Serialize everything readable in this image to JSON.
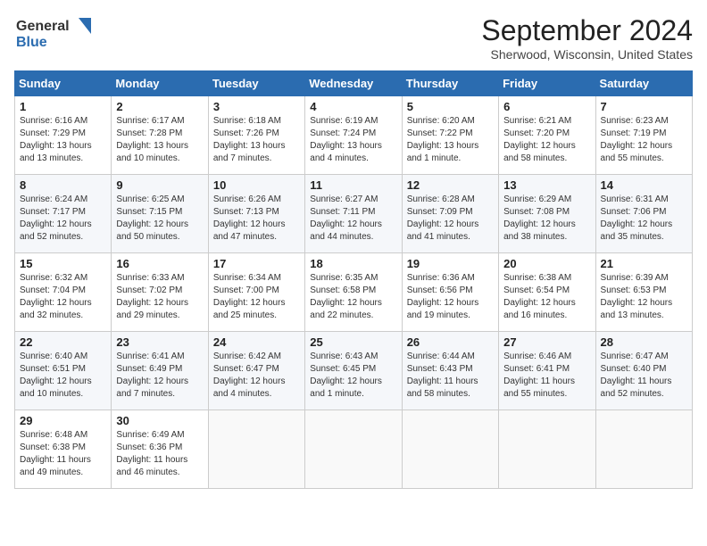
{
  "header": {
    "logo_line1": "General",
    "logo_line2": "Blue",
    "month_year": "September 2024",
    "location": "Sherwood, Wisconsin, United States"
  },
  "days_of_week": [
    "Sunday",
    "Monday",
    "Tuesday",
    "Wednesday",
    "Thursday",
    "Friday",
    "Saturday"
  ],
  "weeks": [
    [
      {
        "day": "1",
        "text": "Sunrise: 6:16 AM\nSunset: 7:29 PM\nDaylight: 13 hours\nand 13 minutes."
      },
      {
        "day": "2",
        "text": "Sunrise: 6:17 AM\nSunset: 7:28 PM\nDaylight: 13 hours\nand 10 minutes."
      },
      {
        "day": "3",
        "text": "Sunrise: 6:18 AM\nSunset: 7:26 PM\nDaylight: 13 hours\nand 7 minutes."
      },
      {
        "day": "4",
        "text": "Sunrise: 6:19 AM\nSunset: 7:24 PM\nDaylight: 13 hours\nand 4 minutes."
      },
      {
        "day": "5",
        "text": "Sunrise: 6:20 AM\nSunset: 7:22 PM\nDaylight: 13 hours\nand 1 minute."
      },
      {
        "day": "6",
        "text": "Sunrise: 6:21 AM\nSunset: 7:20 PM\nDaylight: 12 hours\nand 58 minutes."
      },
      {
        "day": "7",
        "text": "Sunrise: 6:23 AM\nSunset: 7:19 PM\nDaylight: 12 hours\nand 55 minutes."
      }
    ],
    [
      {
        "day": "8",
        "text": "Sunrise: 6:24 AM\nSunset: 7:17 PM\nDaylight: 12 hours\nand 52 minutes."
      },
      {
        "day": "9",
        "text": "Sunrise: 6:25 AM\nSunset: 7:15 PM\nDaylight: 12 hours\nand 50 minutes."
      },
      {
        "day": "10",
        "text": "Sunrise: 6:26 AM\nSunset: 7:13 PM\nDaylight: 12 hours\nand 47 minutes."
      },
      {
        "day": "11",
        "text": "Sunrise: 6:27 AM\nSunset: 7:11 PM\nDaylight: 12 hours\nand 44 minutes."
      },
      {
        "day": "12",
        "text": "Sunrise: 6:28 AM\nSunset: 7:09 PM\nDaylight: 12 hours\nand 41 minutes."
      },
      {
        "day": "13",
        "text": "Sunrise: 6:29 AM\nSunset: 7:08 PM\nDaylight: 12 hours\nand 38 minutes."
      },
      {
        "day": "14",
        "text": "Sunrise: 6:31 AM\nSunset: 7:06 PM\nDaylight: 12 hours\nand 35 minutes."
      }
    ],
    [
      {
        "day": "15",
        "text": "Sunrise: 6:32 AM\nSunset: 7:04 PM\nDaylight: 12 hours\nand 32 minutes."
      },
      {
        "day": "16",
        "text": "Sunrise: 6:33 AM\nSunset: 7:02 PM\nDaylight: 12 hours\nand 29 minutes."
      },
      {
        "day": "17",
        "text": "Sunrise: 6:34 AM\nSunset: 7:00 PM\nDaylight: 12 hours\nand 25 minutes."
      },
      {
        "day": "18",
        "text": "Sunrise: 6:35 AM\nSunset: 6:58 PM\nDaylight: 12 hours\nand 22 minutes."
      },
      {
        "day": "19",
        "text": "Sunrise: 6:36 AM\nSunset: 6:56 PM\nDaylight: 12 hours\nand 19 minutes."
      },
      {
        "day": "20",
        "text": "Sunrise: 6:38 AM\nSunset: 6:54 PM\nDaylight: 12 hours\nand 16 minutes."
      },
      {
        "day": "21",
        "text": "Sunrise: 6:39 AM\nSunset: 6:53 PM\nDaylight: 12 hours\nand 13 minutes."
      }
    ],
    [
      {
        "day": "22",
        "text": "Sunrise: 6:40 AM\nSunset: 6:51 PM\nDaylight: 12 hours\nand 10 minutes."
      },
      {
        "day": "23",
        "text": "Sunrise: 6:41 AM\nSunset: 6:49 PM\nDaylight: 12 hours\nand 7 minutes."
      },
      {
        "day": "24",
        "text": "Sunrise: 6:42 AM\nSunset: 6:47 PM\nDaylight: 12 hours\nand 4 minutes."
      },
      {
        "day": "25",
        "text": "Sunrise: 6:43 AM\nSunset: 6:45 PM\nDaylight: 12 hours\nand 1 minute."
      },
      {
        "day": "26",
        "text": "Sunrise: 6:44 AM\nSunset: 6:43 PM\nDaylight: 11 hours\nand 58 minutes."
      },
      {
        "day": "27",
        "text": "Sunrise: 6:46 AM\nSunset: 6:41 PM\nDaylight: 11 hours\nand 55 minutes."
      },
      {
        "day": "28",
        "text": "Sunrise: 6:47 AM\nSunset: 6:40 PM\nDaylight: 11 hours\nand 52 minutes."
      }
    ],
    [
      {
        "day": "29",
        "text": "Sunrise: 6:48 AM\nSunset: 6:38 PM\nDaylight: 11 hours\nand 49 minutes."
      },
      {
        "day": "30",
        "text": "Sunrise: 6:49 AM\nSunset: 6:36 PM\nDaylight: 11 hours\nand 46 minutes."
      },
      {
        "day": "",
        "text": ""
      },
      {
        "day": "",
        "text": ""
      },
      {
        "day": "",
        "text": ""
      },
      {
        "day": "",
        "text": ""
      },
      {
        "day": "",
        "text": ""
      }
    ]
  ]
}
